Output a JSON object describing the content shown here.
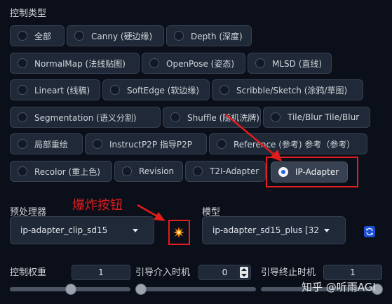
{
  "control_type_label": "控制类型",
  "radio_rows": [
    [
      "全部",
      "Canny (硬边缘)",
      "Depth (深度)"
    ],
    [
      "NormalMap (法线贴图)",
      "OpenPose (姿态)",
      "MLSD (直线)"
    ],
    [
      "Lineart (线稿)",
      "SoftEdge (软边缘)",
      "Scribble/Sketch (涂鸦/草图)"
    ],
    [
      "Segmentation (语义分割)",
      "Shuffle (随机洗牌)",
      "Tile/Blur Tile/Blur"
    ],
    [
      "局部重绘",
      "InstructP2P 指导P2P",
      "Reference (参考) 参考（参考）"
    ],
    [
      "Recolor (重上色)",
      "Revision",
      "T2I-Adapter",
      "IP-Adapter"
    ]
  ],
  "selected": "IP-Adapter",
  "annotation": "爆炸按钮",
  "preprocessor": {
    "label": "预处理器",
    "value": "ip-adapter_clip_sd15"
  },
  "model": {
    "label": "模型",
    "value": "ip-adapter_sd15_plus [32"
  },
  "weight": {
    "label": "控制权重",
    "value": "1",
    "level": 0.5
  },
  "start": {
    "label": "引导介入时机",
    "value": "0",
    "level": 0.0
  },
  "end": {
    "label": "引导终止时机",
    "value": "1",
    "level": 1.0
  },
  "watermark": "知乎 @听雨AGI",
  "colors": {
    "accent": "#2563eb",
    "annotation": "#e11d1d",
    "background": "#0b0f19"
  }
}
